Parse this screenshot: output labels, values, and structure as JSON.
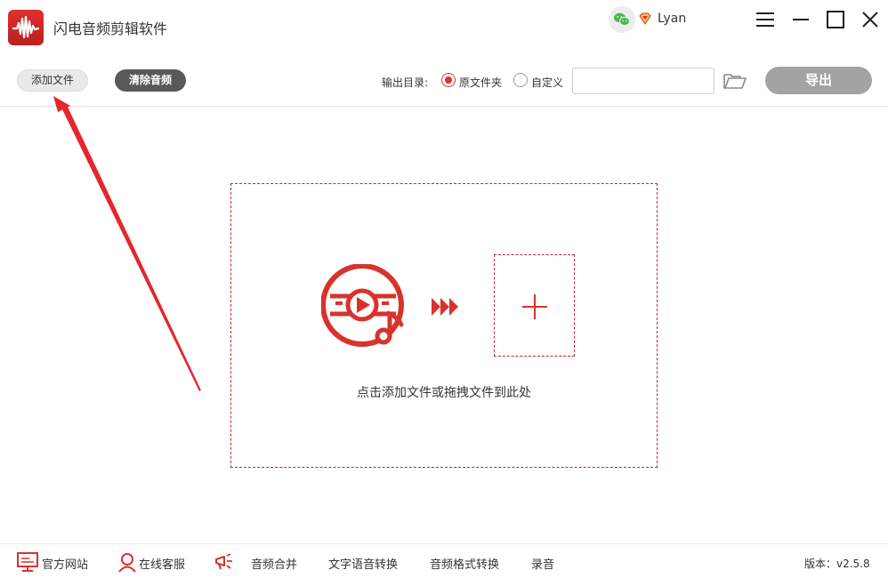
{
  "titlebar": {
    "app_title": "闪电音频剪辑软件",
    "username": "Lyan",
    "icons": [
      "wechat-icon",
      "vip-diamond-icon",
      "menu-icon",
      "minimize-icon",
      "maximize-icon",
      "close-icon"
    ]
  },
  "toolbar": {
    "add_file_label": "添加文件",
    "clear_audio_label": "清除音频",
    "output_dir_label": "输出目录:",
    "radio_original_label": "原文件夹",
    "radio_custom_label": "自定义",
    "selected_output": "原文件夹",
    "path_value": "",
    "export_label": "导出"
  },
  "dropzone": {
    "hint": "点击添加文件或拖拽文件到此处"
  },
  "footer": {
    "official_site": "官方网站",
    "online_service": "在线客服",
    "audio_merge": "音频合并",
    "tts_convert": "文字语音转换",
    "format_convert": "音频格式转换",
    "record": "录音",
    "version": "版本：v2.5.8"
  },
  "colors": {
    "brand_red": "#d9322d",
    "export_disabled": "#a3a3a3",
    "clear_button": "#595959"
  }
}
